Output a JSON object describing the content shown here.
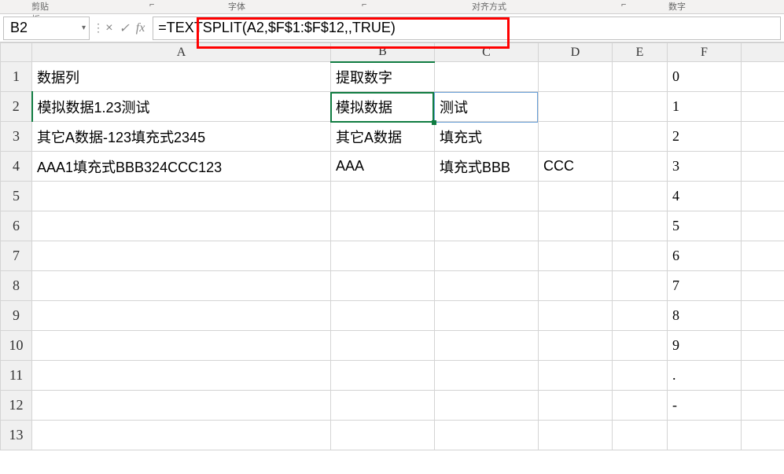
{
  "ribbon": {
    "group1": "剪贴板",
    "group2": "字体",
    "group3": "对齐方式",
    "group4": "数字",
    "dlg": "⌐"
  },
  "nameBox": {
    "value": "B2"
  },
  "formulaBar": {
    "cancel": "×",
    "confirm": "✓",
    "fx": "fx",
    "formula": "=TEXTSPLIT(A2,$F$1:$F$12,,TRUE)"
  },
  "columns": [
    "A",
    "B",
    "C",
    "D",
    "E",
    "F"
  ],
  "rows": [
    "1",
    "2",
    "3",
    "4",
    "5",
    "6",
    "7",
    "8",
    "9",
    "10",
    "11",
    "12",
    "13"
  ],
  "cells": {
    "A1": "数据列",
    "B1": "提取数字",
    "A2": "模拟数据1.23测试",
    "B2": "模拟数据",
    "C2": "测试",
    "A3": "其它A数据-123填充式2345",
    "B3": "其它A数据",
    "C3": "填充式",
    "A4": "AAA1填充式BBB324CCC123",
    "B4": "AAA",
    "C4": "填充式BBB",
    "D4": "CCC",
    "F1": "0",
    "F2": "1",
    "F3": "2",
    "F4": "3",
    "F5": "4",
    "F6": "5",
    "F7": "6",
    "F8": "7",
    "F9": "8",
    "F10": "9",
    "F11": ".",
    "F12": "-"
  }
}
